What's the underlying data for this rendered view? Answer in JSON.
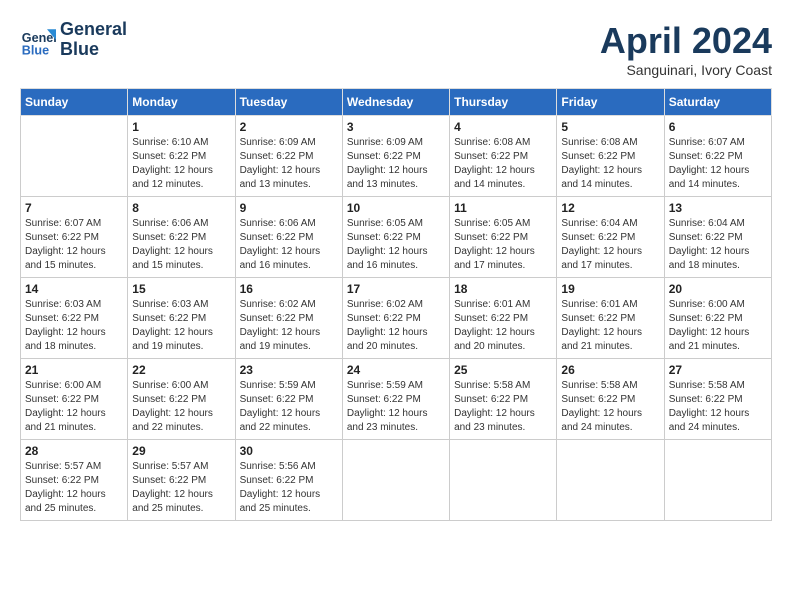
{
  "logo": {
    "text_line1": "General",
    "text_line2": "Blue"
  },
  "title": "April 2024",
  "subtitle": "Sanguinari, Ivory Coast",
  "weekdays": [
    "Sunday",
    "Monday",
    "Tuesday",
    "Wednesday",
    "Thursday",
    "Friday",
    "Saturday"
  ],
  "weeks": [
    [
      {
        "day": "",
        "info": ""
      },
      {
        "day": "1",
        "info": "Sunrise: 6:10 AM\nSunset: 6:22 PM\nDaylight: 12 hours\nand 12 minutes."
      },
      {
        "day": "2",
        "info": "Sunrise: 6:09 AM\nSunset: 6:22 PM\nDaylight: 12 hours\nand 13 minutes."
      },
      {
        "day": "3",
        "info": "Sunrise: 6:09 AM\nSunset: 6:22 PM\nDaylight: 12 hours\nand 13 minutes."
      },
      {
        "day": "4",
        "info": "Sunrise: 6:08 AM\nSunset: 6:22 PM\nDaylight: 12 hours\nand 14 minutes."
      },
      {
        "day": "5",
        "info": "Sunrise: 6:08 AM\nSunset: 6:22 PM\nDaylight: 12 hours\nand 14 minutes."
      },
      {
        "day": "6",
        "info": "Sunrise: 6:07 AM\nSunset: 6:22 PM\nDaylight: 12 hours\nand 14 minutes."
      }
    ],
    [
      {
        "day": "7",
        "info": "Sunrise: 6:07 AM\nSunset: 6:22 PM\nDaylight: 12 hours\nand 15 minutes."
      },
      {
        "day": "8",
        "info": "Sunrise: 6:06 AM\nSunset: 6:22 PM\nDaylight: 12 hours\nand 15 minutes."
      },
      {
        "day": "9",
        "info": "Sunrise: 6:06 AM\nSunset: 6:22 PM\nDaylight: 12 hours\nand 16 minutes."
      },
      {
        "day": "10",
        "info": "Sunrise: 6:05 AM\nSunset: 6:22 PM\nDaylight: 12 hours\nand 16 minutes."
      },
      {
        "day": "11",
        "info": "Sunrise: 6:05 AM\nSunset: 6:22 PM\nDaylight: 12 hours\nand 17 minutes."
      },
      {
        "day": "12",
        "info": "Sunrise: 6:04 AM\nSunset: 6:22 PM\nDaylight: 12 hours\nand 17 minutes."
      },
      {
        "day": "13",
        "info": "Sunrise: 6:04 AM\nSunset: 6:22 PM\nDaylight: 12 hours\nand 18 minutes."
      }
    ],
    [
      {
        "day": "14",
        "info": "Sunrise: 6:03 AM\nSunset: 6:22 PM\nDaylight: 12 hours\nand 18 minutes."
      },
      {
        "day": "15",
        "info": "Sunrise: 6:03 AM\nSunset: 6:22 PM\nDaylight: 12 hours\nand 19 minutes."
      },
      {
        "day": "16",
        "info": "Sunrise: 6:02 AM\nSunset: 6:22 PM\nDaylight: 12 hours\nand 19 minutes."
      },
      {
        "day": "17",
        "info": "Sunrise: 6:02 AM\nSunset: 6:22 PM\nDaylight: 12 hours\nand 20 minutes."
      },
      {
        "day": "18",
        "info": "Sunrise: 6:01 AM\nSunset: 6:22 PM\nDaylight: 12 hours\nand 20 minutes."
      },
      {
        "day": "19",
        "info": "Sunrise: 6:01 AM\nSunset: 6:22 PM\nDaylight: 12 hours\nand 21 minutes."
      },
      {
        "day": "20",
        "info": "Sunrise: 6:00 AM\nSunset: 6:22 PM\nDaylight: 12 hours\nand 21 minutes."
      }
    ],
    [
      {
        "day": "21",
        "info": "Sunrise: 6:00 AM\nSunset: 6:22 PM\nDaylight: 12 hours\nand 21 minutes."
      },
      {
        "day": "22",
        "info": "Sunrise: 6:00 AM\nSunset: 6:22 PM\nDaylight: 12 hours\nand 22 minutes."
      },
      {
        "day": "23",
        "info": "Sunrise: 5:59 AM\nSunset: 6:22 PM\nDaylight: 12 hours\nand 22 minutes."
      },
      {
        "day": "24",
        "info": "Sunrise: 5:59 AM\nSunset: 6:22 PM\nDaylight: 12 hours\nand 23 minutes."
      },
      {
        "day": "25",
        "info": "Sunrise: 5:58 AM\nSunset: 6:22 PM\nDaylight: 12 hours\nand 23 minutes."
      },
      {
        "day": "26",
        "info": "Sunrise: 5:58 AM\nSunset: 6:22 PM\nDaylight: 12 hours\nand 24 minutes."
      },
      {
        "day": "27",
        "info": "Sunrise: 5:58 AM\nSunset: 6:22 PM\nDaylight: 12 hours\nand 24 minutes."
      }
    ],
    [
      {
        "day": "28",
        "info": "Sunrise: 5:57 AM\nSunset: 6:22 PM\nDaylight: 12 hours\nand 25 minutes."
      },
      {
        "day": "29",
        "info": "Sunrise: 5:57 AM\nSunset: 6:22 PM\nDaylight: 12 hours\nand 25 minutes."
      },
      {
        "day": "30",
        "info": "Sunrise: 5:56 AM\nSunset: 6:22 PM\nDaylight: 12 hours\nand 25 minutes."
      },
      {
        "day": "",
        "info": ""
      },
      {
        "day": "",
        "info": ""
      },
      {
        "day": "",
        "info": ""
      },
      {
        "day": "",
        "info": ""
      }
    ]
  ]
}
